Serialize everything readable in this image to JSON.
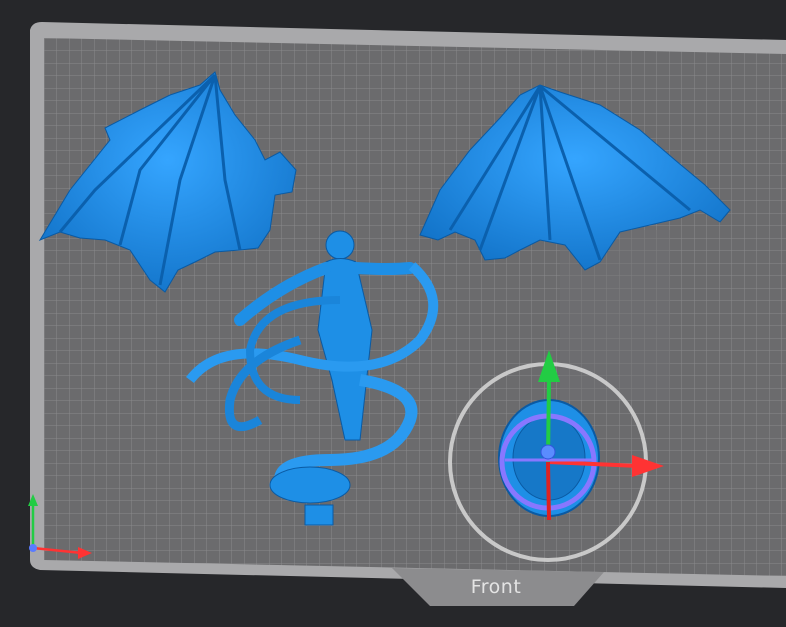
{
  "viewport": {
    "plate_label": "Front",
    "model_color": "#1e8fe6",
    "plate_color": "#6e6e70",
    "grid_color": "#8a8a8c",
    "background_color": "#26272a"
  },
  "objects": [
    {
      "name": "left-wing"
    },
    {
      "name": "right-wing"
    },
    {
      "name": "demon-figure"
    },
    {
      "name": "round-base"
    }
  ],
  "gizmo": {
    "axes": [
      {
        "axis": "x",
        "color": "#ff3333"
      },
      {
        "axis": "y",
        "color": "#22cc44"
      },
      {
        "axis": "z",
        "color": "#4466ff"
      }
    ],
    "rotate_ring_color": "#8877ff",
    "scale_ring_color": "#d8d8d8"
  },
  "orientation_indicator": {
    "axes": [
      "x",
      "y",
      "z"
    ]
  }
}
